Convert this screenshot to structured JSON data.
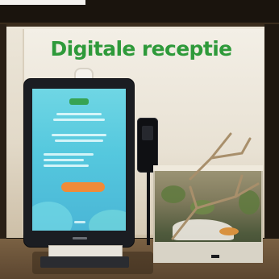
{
  "sign": {
    "text": "Digitale receptie",
    "color": "#2e9a3a"
  },
  "colors": {
    "screen": "#55c8de",
    "screen_button": "#f08b38",
    "bezel": "#1b1d22",
    "wall": "#ece6d9",
    "counter": "#6b533a"
  }
}
